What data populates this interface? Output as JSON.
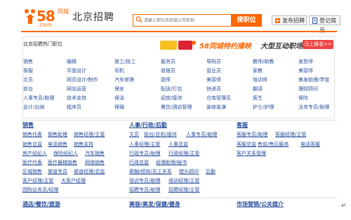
{
  "header": {
    "logo_number": "58",
    "logo_dot": ".com",
    "logo_tc": "同城",
    "city_title": "北京招聘",
    "search_placeholder": "请输入职位名称或公司名称",
    "search_button": "搜职位",
    "post_button": "发布招聘",
    "resume_button": "登记简历",
    "colors": {
      "brand": "#ff6600",
      "link": "#2a4f9c"
    }
  },
  "hot": {
    "title": "北京招聘热门职位",
    "banner_text": "58同城特约播映",
    "banner_text2": "大型互动职场真人秀",
    "banner_button": "马上报名>>",
    "columns": [
      [
        "销售",
        "客服",
        "文员",
        "前台",
        "人事专员/助理",
        "会计/出纳"
      ],
      [
        "编辑",
        "平面设计",
        "网页设计/制作",
        "网站运营",
        "技术支持",
        "程序员"
      ],
      [
        "普工/技工",
        "司机",
        "汽车修理",
        "保安",
        "保洁",
        "保姆"
      ],
      [
        "服务员",
        "收银员",
        "厨师",
        "配送/打包",
        "迎宾/接待",
        "餐饮/酒店管理"
      ],
      [
        "导购员",
        "营业员",
        "美容师",
        "快递员",
        "仓库管理员",
        "装修装潢"
      ],
      [
        "教师/助教",
        "家教",
        "培训师",
        "翻译",
        "医生",
        "护士/护理"
      ],
      [
        "发型师",
        "美容师",
        "美发助理/学徒",
        "理财顾问",
        "保险",
        "法务专员/助理"
      ]
    ]
  },
  "categories": [
    {
      "title": "销售",
      "rows": [
        [
          "销售代表",
          "销售助理",
          "销售经理/主管"
        ],
        [
          "销售总监",
          "电话销售",
          "销售支持"
        ],
        [
          "房产经纪人",
          "保险经纪人",
          "汽车销售"
        ],
        [
          "医疗代表",
          "医疗器械销售",
          "网络销售"
        ],
        [
          "区域销售",
          "渠道专员",
          "渠道经理/总监"
        ],
        [
          "客户经理/主管",
          "大客户经理"
        ],
        [
          "团购业务员/经理"
        ]
      ]
    },
    {
      "title": "人事/行政/后勤",
      "rows": [
        [
          "文员",
          "前台/总机/接待",
          "人事专员/助理"
        ],
        [
          "人事经理/主管",
          "人事总监"
        ],
        [
          "行政专员/助理",
          "行政经理/主管"
        ],
        [
          "行政总监",
          "经理助理/秘书"
        ],
        [
          "薪酬/绩效/员工关系",
          "猎头顾问",
          "后勤"
        ],
        [
          "培训专员/助理",
          "培训经理/主管"
        ],
        [
          "招聘专员/助理",
          "招聘经理/主管"
        ]
      ]
    },
    {
      "title": "客服",
      "rows": [
        [
          "客服专员/助理",
          "客服经理/主管"
        ],
        [
          "客服总监",
          "售前/售后服务",
          "电话客服"
        ],
        [
          "客户关系管理"
        ]
      ]
    }
  ],
  "bottom_titles": [
    "酒店/餐饮/旅游",
    "美容/美发/保健/健身",
    "市场营销/公关媒介"
  ],
  "return_mark": "↵"
}
